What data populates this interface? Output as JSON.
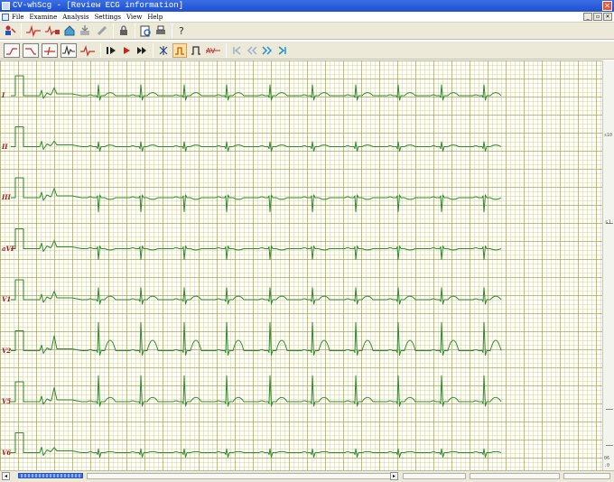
{
  "window": {
    "title": "CV-whScg - [Review ECG information]",
    "close_glyph": "✕"
  },
  "menu": {
    "items": [
      "File",
      "Examine",
      "Analysis",
      "Settings",
      "View",
      "Help"
    ],
    "win_controls": [
      "_",
      "▫",
      "✕"
    ]
  },
  "leads": [
    {
      "name": "I",
      "amp": 1.0,
      "tw": 0.35,
      "small": false
    },
    {
      "name": "II",
      "amp": 0.45,
      "tw": 0.2,
      "small": true
    },
    {
      "name": "III",
      "amp": -1.3,
      "tw": -0.2,
      "small": false
    },
    {
      "name": "aVF",
      "amp": -1.0,
      "tw": -0.15,
      "small": false
    },
    {
      "name": "V1",
      "amp": 1.1,
      "tw": 0.4,
      "small": false
    },
    {
      "name": "V2",
      "amp": 2.6,
      "tw": 1.2,
      "small": false
    },
    {
      "name": "V5",
      "amp": 2.4,
      "tw": 0.5,
      "small": false
    },
    {
      "name": "V6",
      "amp": 0.35,
      "tw": 0.12,
      "small": true
    }
  ],
  "side_marks": [
    "s10",
    "s1",
    "06",
    ".0"
  ],
  "colors": {
    "trace": "#2f8a2f",
    "lead_label": "#9b1c1c",
    "grid_major": "#96965a",
    "grid_minor": "#bebe8c"
  }
}
